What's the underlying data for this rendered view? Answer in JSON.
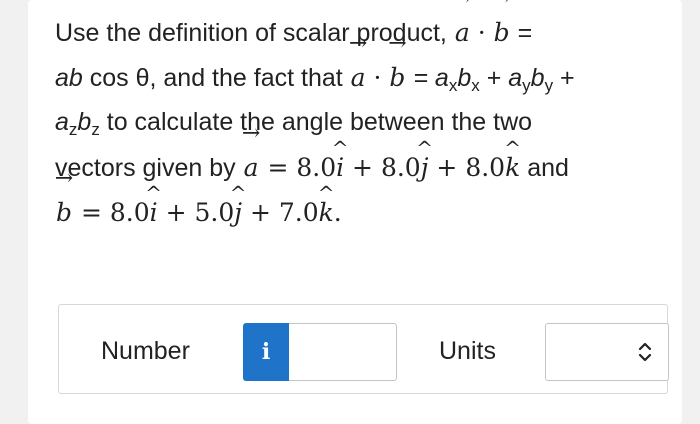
{
  "question": {
    "l1_text": "Use the definition of scalar product, ",
    "vec_a": "a",
    "vec_b": "b",
    "dot": "·",
    "eq": "=",
    "arrow": "→",
    "l2_ab": "ab",
    "l2_cos": " cos θ, and the fact that ",
    "l2_rhs": " = a",
    "sub_x": "x",
    "sub_y": "y",
    "sub_z": "z",
    "b": "b",
    "a": "a",
    "plus": " + ",
    "l3_rest": " to calculate the angle between the two",
    "l4_text": "vectors given by ",
    "a_eq": " = 8.0",
    "coef_8": " + 8.0",
    "coef_5": " + 5.0",
    "coef_7": " + 7.0",
    "and": " and",
    "b_eq": " = 8.0",
    "i": "i",
    "j": "j",
    "k": "k",
    "hat": "^",
    "period": "."
  },
  "answer": {
    "number_label": "Number",
    "info_icon": "i",
    "number_value": "",
    "units_label": "Units",
    "units_value": ""
  },
  "colors": {
    "info_button": "#1f74c9"
  }
}
